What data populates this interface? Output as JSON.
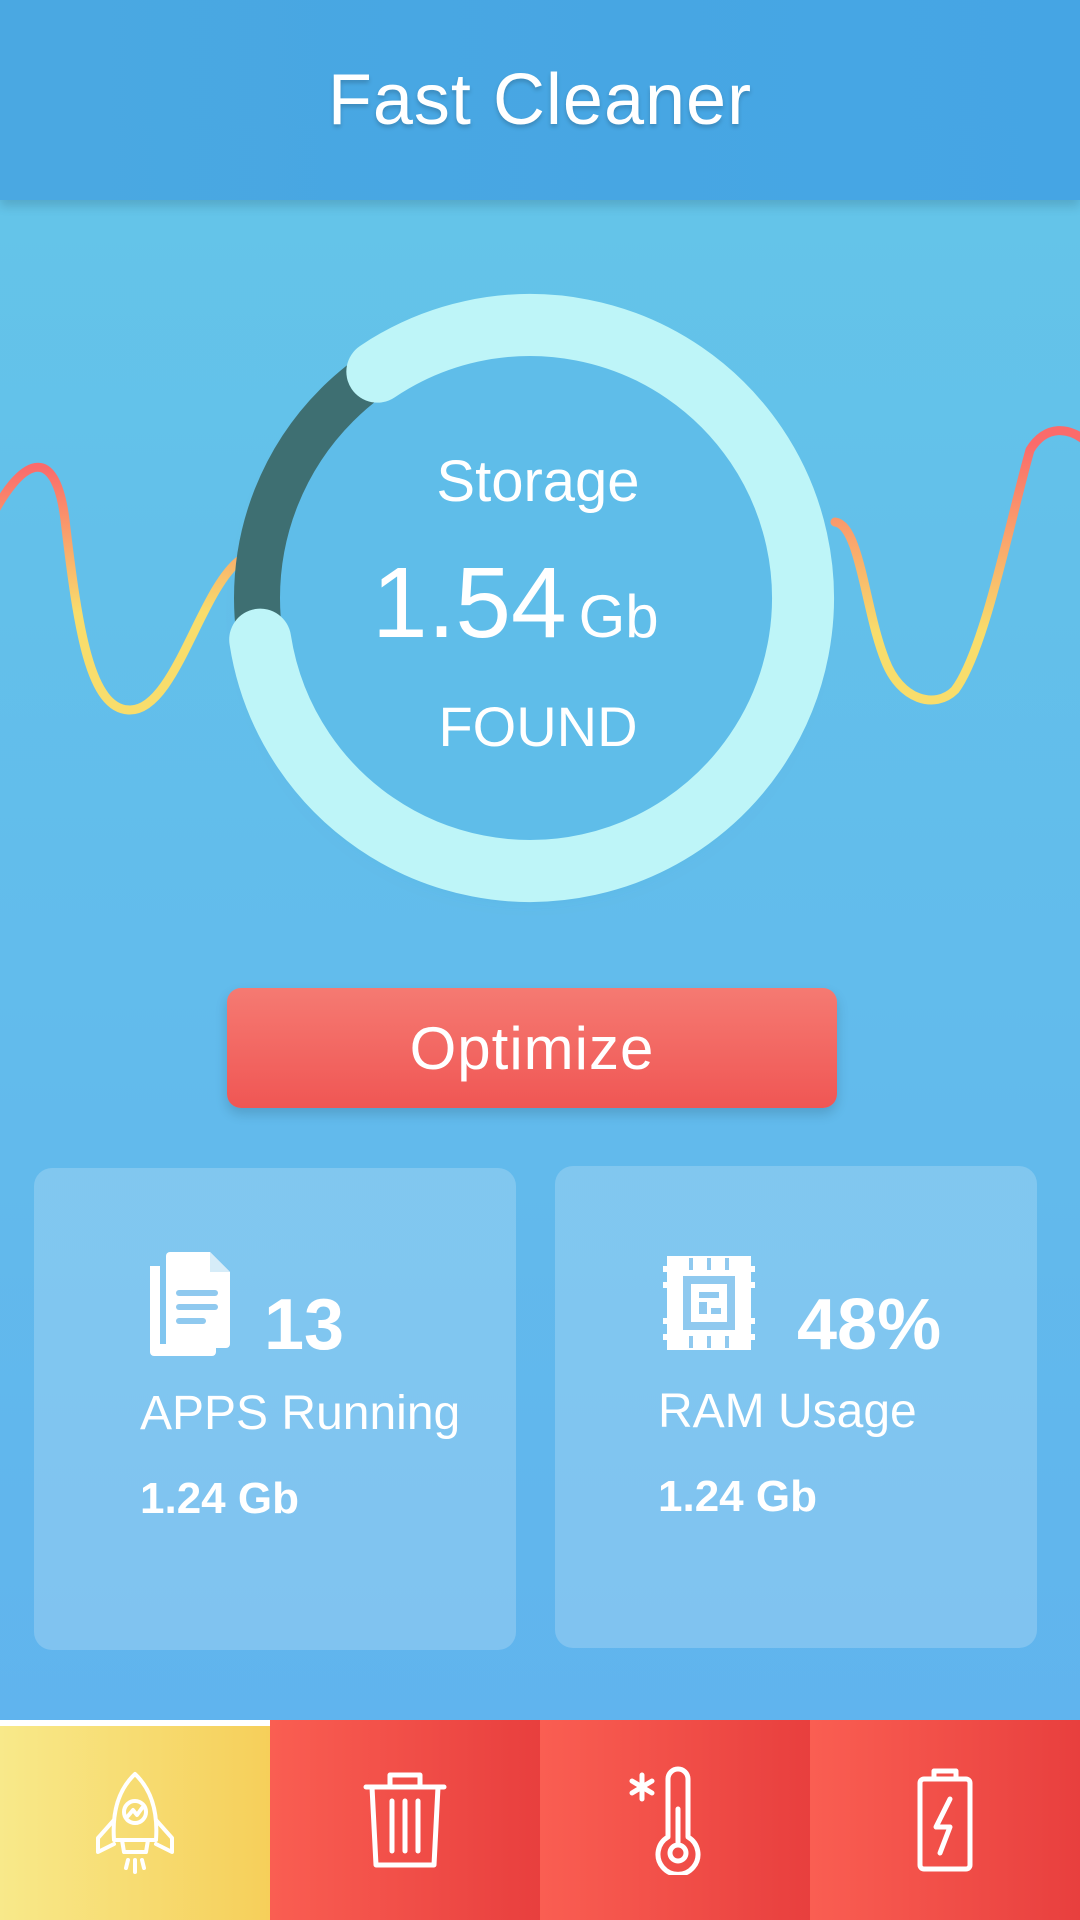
{
  "header": {
    "title": "Fast Cleaner"
  },
  "storage": {
    "label": "Storage",
    "value": "1.54",
    "unit": "Gb",
    "status": "FOUND",
    "ring_fill_fraction": 0.82
  },
  "actions": {
    "optimize_label": "Optimize"
  },
  "cards": {
    "apps": {
      "count": "13",
      "label": "APPS Running",
      "size": "1.24 Gb",
      "icon": "document-icon"
    },
    "ram": {
      "percent": "48%",
      "label": "RAM Usage",
      "size": "1.24 Gb",
      "icon": "chip-icon"
    }
  },
  "tabs": [
    {
      "icon": "rocket-icon",
      "active": true
    },
    {
      "icon": "trash-icon",
      "active": false
    },
    {
      "icon": "thermometer-icon",
      "active": false
    },
    {
      "icon": "battery-icon",
      "active": false
    }
  ],
  "colors": {
    "header_bg": "#47a6e3",
    "ring_light": "#bef5f8",
    "ring_dark": "#3e6f72",
    "wave_red": "#fb6b6b",
    "wave_yellow": "#f8dd6c",
    "button_red": "#f05654",
    "tab_active": "#f7dc72",
    "tab_inactive": "#f24f49"
  }
}
